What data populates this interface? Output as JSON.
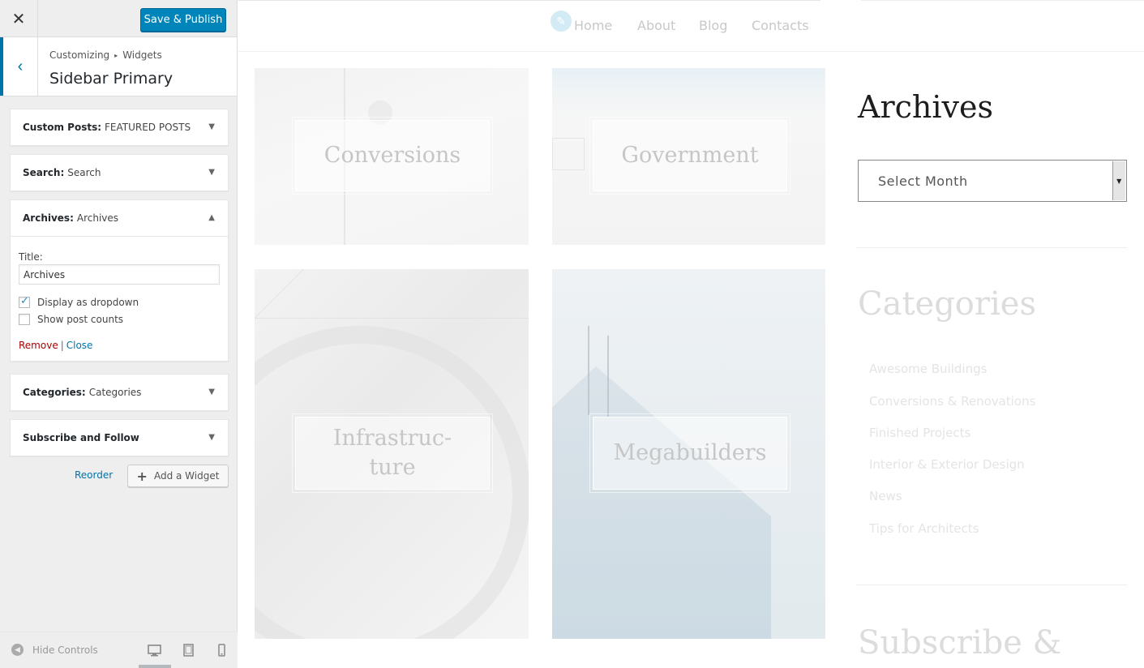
{
  "customizer": {
    "close_icon": "close-icon",
    "publish_label": "Save & Publish",
    "breadcrumb": {
      "root": "Customizing",
      "current": "Widgets"
    },
    "section_title": "Sidebar Primary",
    "widgets": [
      {
        "type": "Custom Posts:",
        "title": "FEATURED POSTS",
        "expanded": false
      },
      {
        "type": "Search:",
        "title": "Search",
        "expanded": false
      },
      {
        "type": "Archives:",
        "title": "Archives",
        "expanded": true
      },
      {
        "type": "Categories:",
        "title": "Categories",
        "expanded": false
      },
      {
        "type": "Subscribe and Follow",
        "title": "",
        "expanded": false
      }
    ],
    "archives_form": {
      "title_label": "Title:",
      "title_value": "Archives",
      "dropdown_label": "Display as dropdown",
      "dropdown_checked": true,
      "counts_label": "Show post counts",
      "counts_checked": false,
      "remove_label": "Remove",
      "separator": "|",
      "close_label": "Close"
    },
    "reorder_label": "Reorder",
    "add_widget_label": "Add a Widget",
    "footer": {
      "hide_controls_label": "Hide Controls",
      "active_device": "desktop"
    }
  },
  "preview": {
    "nav": [
      "Home",
      "About",
      "Blog",
      "Contacts"
    ],
    "tiles": [
      {
        "lines": [
          "Conversions"
        ]
      },
      {
        "lines": [
          "Government"
        ]
      },
      {
        "lines": [
          "Infrastruc-",
          "ture"
        ]
      },
      {
        "lines": [
          "Megabuilders"
        ]
      }
    ],
    "archives_title": "Archives",
    "select_placeholder": "Select Month",
    "categories_title": "Categories",
    "categories": [
      "Awesome Buildings",
      "Conversions & Renovations",
      "Finished Projects",
      "Interior & Exterior Design",
      "News",
      "Tips for Architects"
    ],
    "subscribe_title": "Subscribe &"
  },
  "colors": {
    "accent": "#0073aa",
    "publish": "#0085ba",
    "remove": "#aa0000"
  }
}
